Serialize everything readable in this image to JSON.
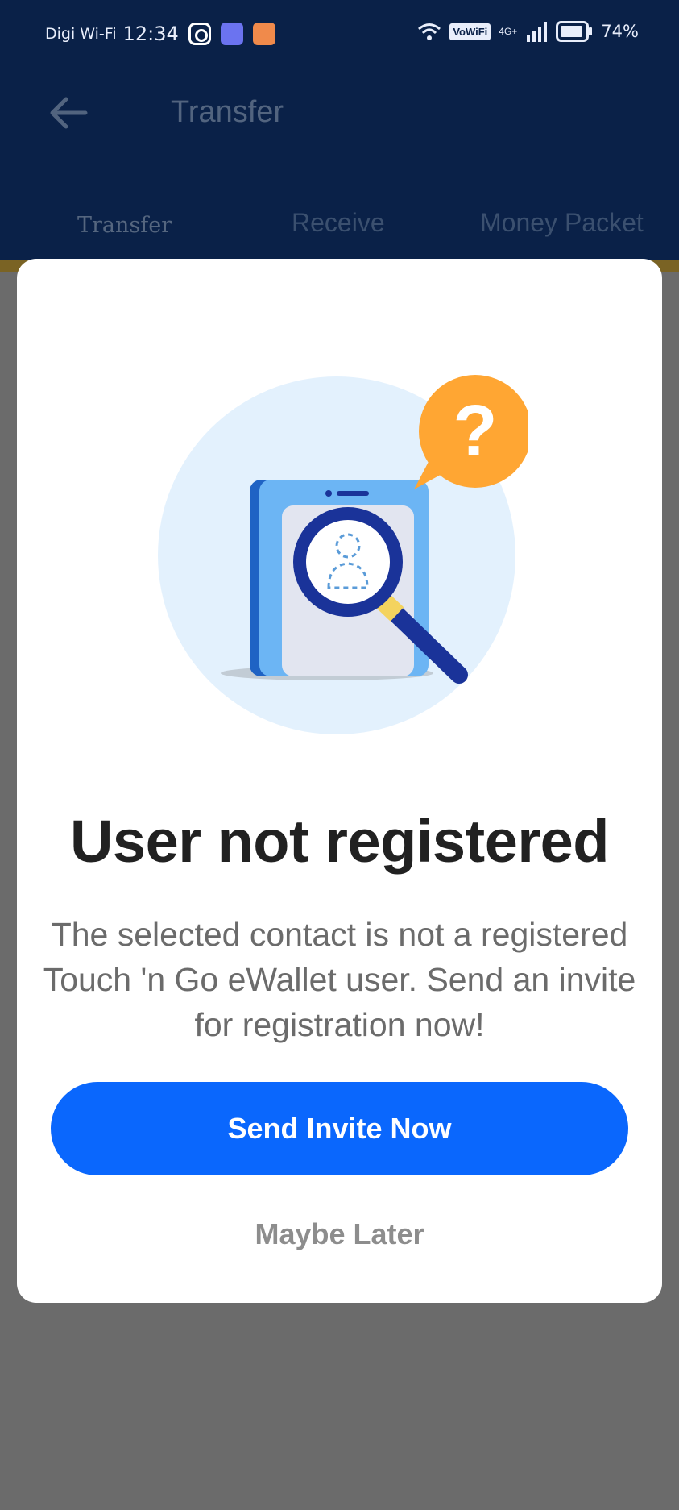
{
  "status_bar": {
    "carrier": "Digi Wi-Fi",
    "time": "12:34",
    "vowifi": "VoWiFi",
    "network": "4G+",
    "battery": "74%",
    "icons": [
      "instagram-icon",
      "app-icon-purple",
      "app-icon-orange",
      "wifi-icon",
      "signal-icon",
      "battery-icon"
    ]
  },
  "header": {
    "title": "Transfer",
    "back_icon": "arrow-left-icon"
  },
  "tabs": [
    {
      "label": "Transfer"
    },
    {
      "label": "Receive"
    },
    {
      "label": "Money Packet"
    }
  ],
  "modal": {
    "illustration_icon": "user-search-icon",
    "title": "User not registered",
    "message": "The selected contact is not a registered Touch 'n Go eWallet user. Send an invite for registration now!",
    "primary_button": "Send Invite Now",
    "secondary_button": "Maybe Later"
  },
  "colors": {
    "header_bg": "#0a2148",
    "overlay": "#6b6b6b",
    "primary": "#0a67fd",
    "question_badge": "#ffa633",
    "magnifier": "#1a3399"
  }
}
